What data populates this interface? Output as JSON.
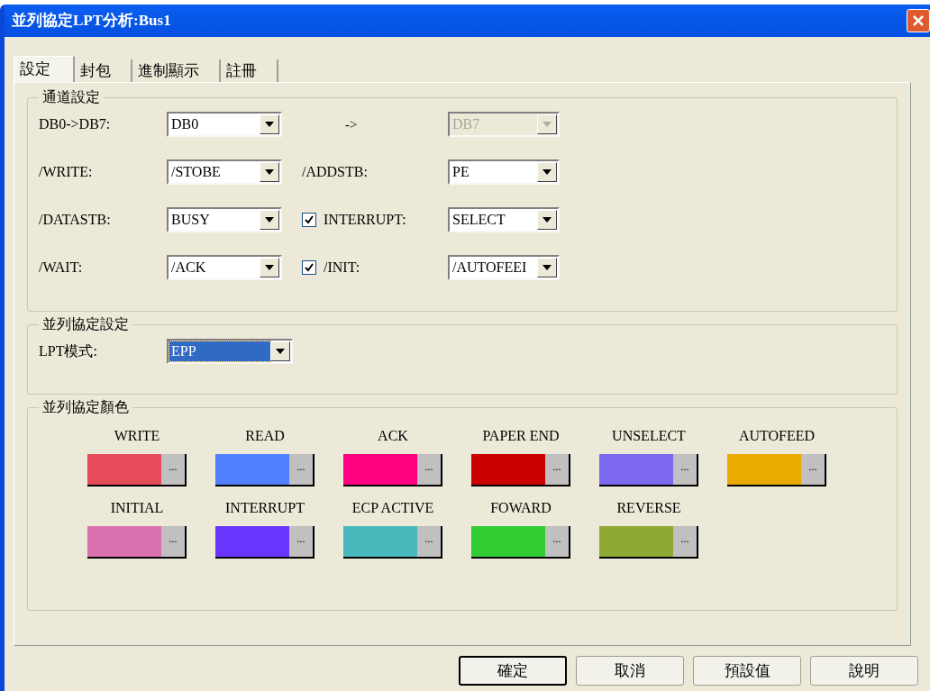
{
  "window": {
    "title": "並列協定LPT分析:Bus1"
  },
  "tabs": [
    {
      "label": "設定",
      "selected": true
    },
    {
      "label": "封包",
      "selected": false
    },
    {
      "label": "進制顯示",
      "selected": false
    },
    {
      "label": "註冊",
      "selected": false
    }
  ],
  "channel_settings": {
    "title": "通道設定",
    "rows": [
      {
        "label": "DB0->DB7:",
        "value": "DB0",
        "middle": {
          "kind": "arrow",
          "label": "->"
        },
        "right": {
          "value": "DB7",
          "disabled": true
        }
      },
      {
        "label": "/WRITE:",
        "value": "/STOBE",
        "middle": {
          "kind": "label",
          "label": "/ADDSTB:"
        },
        "right": {
          "value": "PE",
          "disabled": false
        }
      },
      {
        "label": "/DATASTB:",
        "value": "BUSY",
        "middle": {
          "kind": "checkbox",
          "label": "INTERRUPT:",
          "checked": true
        },
        "right": {
          "value": "SELECT",
          "disabled": false
        }
      },
      {
        "label": "/WAIT:",
        "value": "/ACK",
        "middle": {
          "kind": "checkbox",
          "label": "/INIT:",
          "checked": true
        },
        "right": {
          "value": "/AUTOFEEI",
          "disabled": false
        }
      }
    ]
  },
  "protocol_settings": {
    "title": "並列協定設定",
    "label": "LPT模式:",
    "value": "EPP",
    "focused": true
  },
  "protocol_colors": {
    "title": "並列協定顏色",
    "items": [
      {
        "label": "WRITE",
        "color": "#e64b5a",
        "more": "..."
      },
      {
        "label": "READ",
        "color": "#5080ff",
        "more": "..."
      },
      {
        "label": "ACK",
        "color": "#ff0080",
        "more": "..."
      },
      {
        "label": "PAPER END",
        "color": "#cc0000",
        "more": "..."
      },
      {
        "label": "UNSELECT",
        "color": "#7b68ee",
        "more": "..."
      },
      {
        "label": "AUTOFEED",
        "color": "#eaaa00",
        "more": "..."
      },
      {
        "label": "INITIAL",
        "color": "#da70b0",
        "more": "..."
      },
      {
        "label": "INTERRUPT",
        "color": "#6a35ff",
        "more": "..."
      },
      {
        "label": "ECP ACTIVE",
        "color": "#48b8bc",
        "more": "..."
      },
      {
        "label": "FOWARD",
        "color": "#33cc33",
        "more": "..."
      },
      {
        "label": "REVERSE",
        "color": "#8faa33",
        "more": "..."
      }
    ]
  },
  "buttons": [
    {
      "label": "確定",
      "default": true
    },
    {
      "label": "取消",
      "default": false
    },
    {
      "label": "預設值",
      "default": false
    },
    {
      "label": "說明",
      "default": false
    }
  ]
}
